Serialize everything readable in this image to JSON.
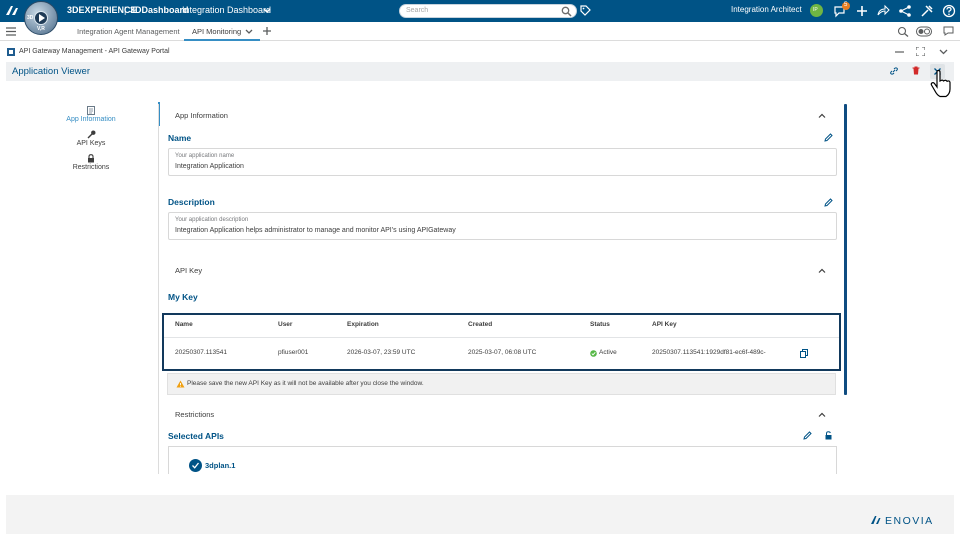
{
  "topbar": {
    "brand_3d": "3DEXPERIENCE",
    "brand_sep": " | ",
    "brand_dashboard": "3DDashboard",
    "dashboard_name": "Integration Dashboard",
    "search_placeholder": "Search",
    "user_role": "Integration Architect",
    "notification_count": "5",
    "compass_label": "3D",
    "compass_version": "V,R",
    "colors": {
      "bar": "#005386",
      "accent": "#368ec4"
    }
  },
  "tabs": [
    {
      "label": "Integration Agent Management"
    },
    {
      "label": "API Monitoring"
    }
  ],
  "widget": {
    "title": "API Gateway Management - API Gateway Portal"
  },
  "app_viewer": {
    "title": "Application Viewer"
  },
  "left_nav": [
    {
      "label": "App Information",
      "icon": "document-icon",
      "active": true
    },
    {
      "label": "API Keys",
      "icon": "key-icon"
    },
    {
      "label": "Restrictions",
      "icon": "lock-icon"
    }
  ],
  "app_info": {
    "section_label": "App Information",
    "name_heading": "Name",
    "name_field_label": "Your application name",
    "name_value": "Integration Application",
    "desc_heading": "Description",
    "desc_field_label": "Your application description",
    "desc_value": "Integration Application helps administrator to manage and monitor API's using APIGateway"
  },
  "api_key": {
    "section_label": "API Key",
    "heading": "My Key",
    "columns": [
      "Name",
      "User",
      "Expiration",
      "Created",
      "Status",
      "API Key"
    ],
    "row": {
      "name": "20250307.113541",
      "user": "pfiuser001",
      "expiration": "2026-03-07, 23:59 UTC",
      "created": "2025-03-07, 06:08 UTC",
      "status": "Active",
      "api_key": "20250307.113541:1929df81-ec6f-489c-"
    },
    "warning": "Please save the new API Key as it will not be available after you close the window.",
    "status_color": "#57b847"
  },
  "restrictions": {
    "section_label": "Restrictions",
    "heading": "Selected APIs",
    "apis": [
      "3dplan.1"
    ]
  },
  "footer": {
    "brand": "ENOVIA"
  }
}
